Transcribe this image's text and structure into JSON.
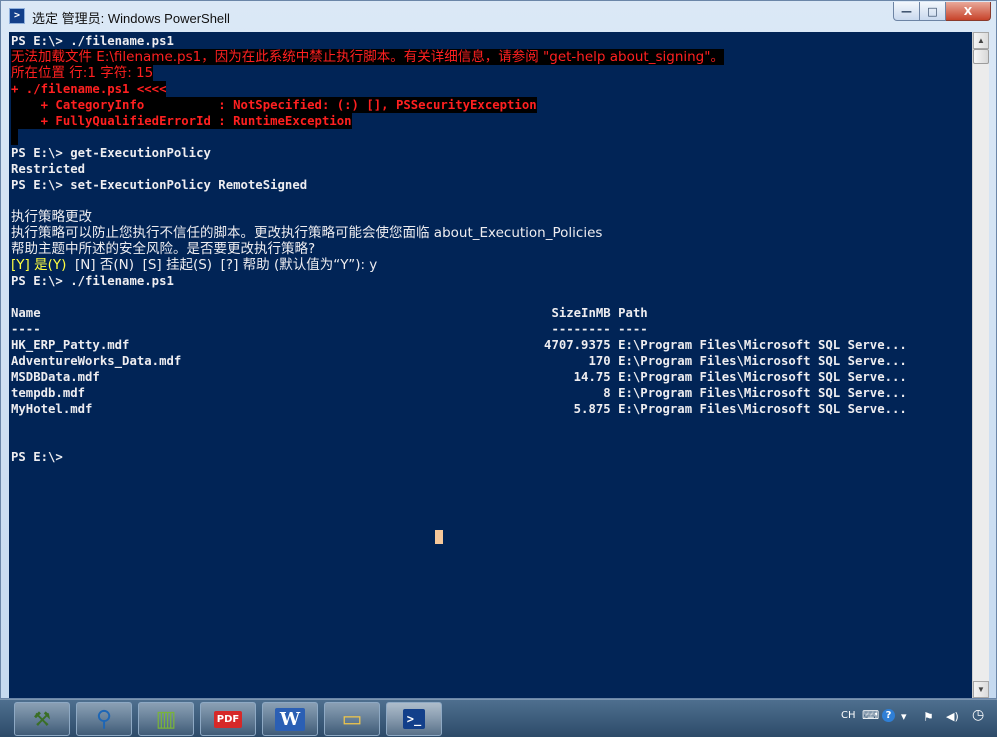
{
  "window": {
    "title": "选定 管理员: Windows PowerShell",
    "minimize_glyph": "—",
    "maximize_glyph": "□",
    "close_glyph": "X"
  },
  "console": {
    "line_01": "PS E:\\> ./filename.ps1",
    "line_02": "无法加载文件 E:\\filename.ps1，因为在此系统中禁止执行脚本。有关详细信息，请参阅 \"get-help about_signing\"。",
    "line_03": "所在位置 行:1 字符: 15",
    "line_04": "+ ./filename.ps1 <<<<",
    "line_05": "    + CategoryInfo          : NotSpecified: (:) [], PSSecurityException",
    "line_06": "    + FullyQualifiedErrorId : RuntimeException",
    "line_07": " ",
    "line_08": "PS E:\\> get-ExecutionPolicy",
    "line_09": "Restricted",
    "line_10": "PS E:\\> set-ExecutionPolicy RemoteSigned",
    "line_11": "执行策略更改",
    "line_12": "执行策略可以防止您执行不信任的脚本。更改执行策略可能会使您面临 about_Execution_Policies",
    "line_13": "帮助主题中所述的安全风险。是否要更改执行策略?",
    "line_14_yes": "[Y] 是(Y)",
    "line_14_rest": "  [N] 否(N)  [S] 挂起(S)  [?] 帮助 (默认值为“Y”): y",
    "line_15": "PS E:\\> ./filename.ps1",
    "table": {
      "header": "Name                                                                     SizeInMB Path",
      "separator": "----                                                                     -------- ----",
      "rows": [
        "HK_ERP_Patty.mdf                                                        4707.9375 E:\\Program Files\\Microsoft SQL Serve...",
        "AdventureWorks_Data.mdf                                                       170 E:\\Program Files\\Microsoft SQL Serve...",
        "MSDBData.mdf                                                                14.75 E:\\Program Files\\Microsoft SQL Serve...",
        "tempdb.mdf                                                                      8 E:\\Program Files\\Microsoft SQL Serve...",
        "MyHotel.mdf                                                                 5.875 E:\\Program Files\\Microsoft SQL Serve..."
      ]
    },
    "prompt_final": "PS E:\\>"
  },
  "taskbar": {
    "items": [
      {
        "name": "network-tools-icon",
        "glyph": "⚒"
      },
      {
        "name": "search-magnifier-icon",
        "glyph": "⚲"
      },
      {
        "name": "library-books-icon",
        "glyph": "▥"
      },
      {
        "name": "pdf-icon",
        "glyph": "PDF"
      },
      {
        "name": "word-icon",
        "glyph": "W"
      },
      {
        "name": "folder-icon",
        "glyph": "▭"
      },
      {
        "name": "powershell-icon",
        "glyph": ">_"
      }
    ],
    "language": "CH",
    "keyboard_glyph": "⌨",
    "help_glyph": "?",
    "flag_glyph": "⚑",
    "volume_glyph": "◀)",
    "clock_glyph": "◷"
  },
  "colors": {
    "console_bg": "#012456",
    "console_fg": "#eeedf0",
    "error_fg": "#ff2020",
    "prompt_highlight": "#ffff40"
  }
}
